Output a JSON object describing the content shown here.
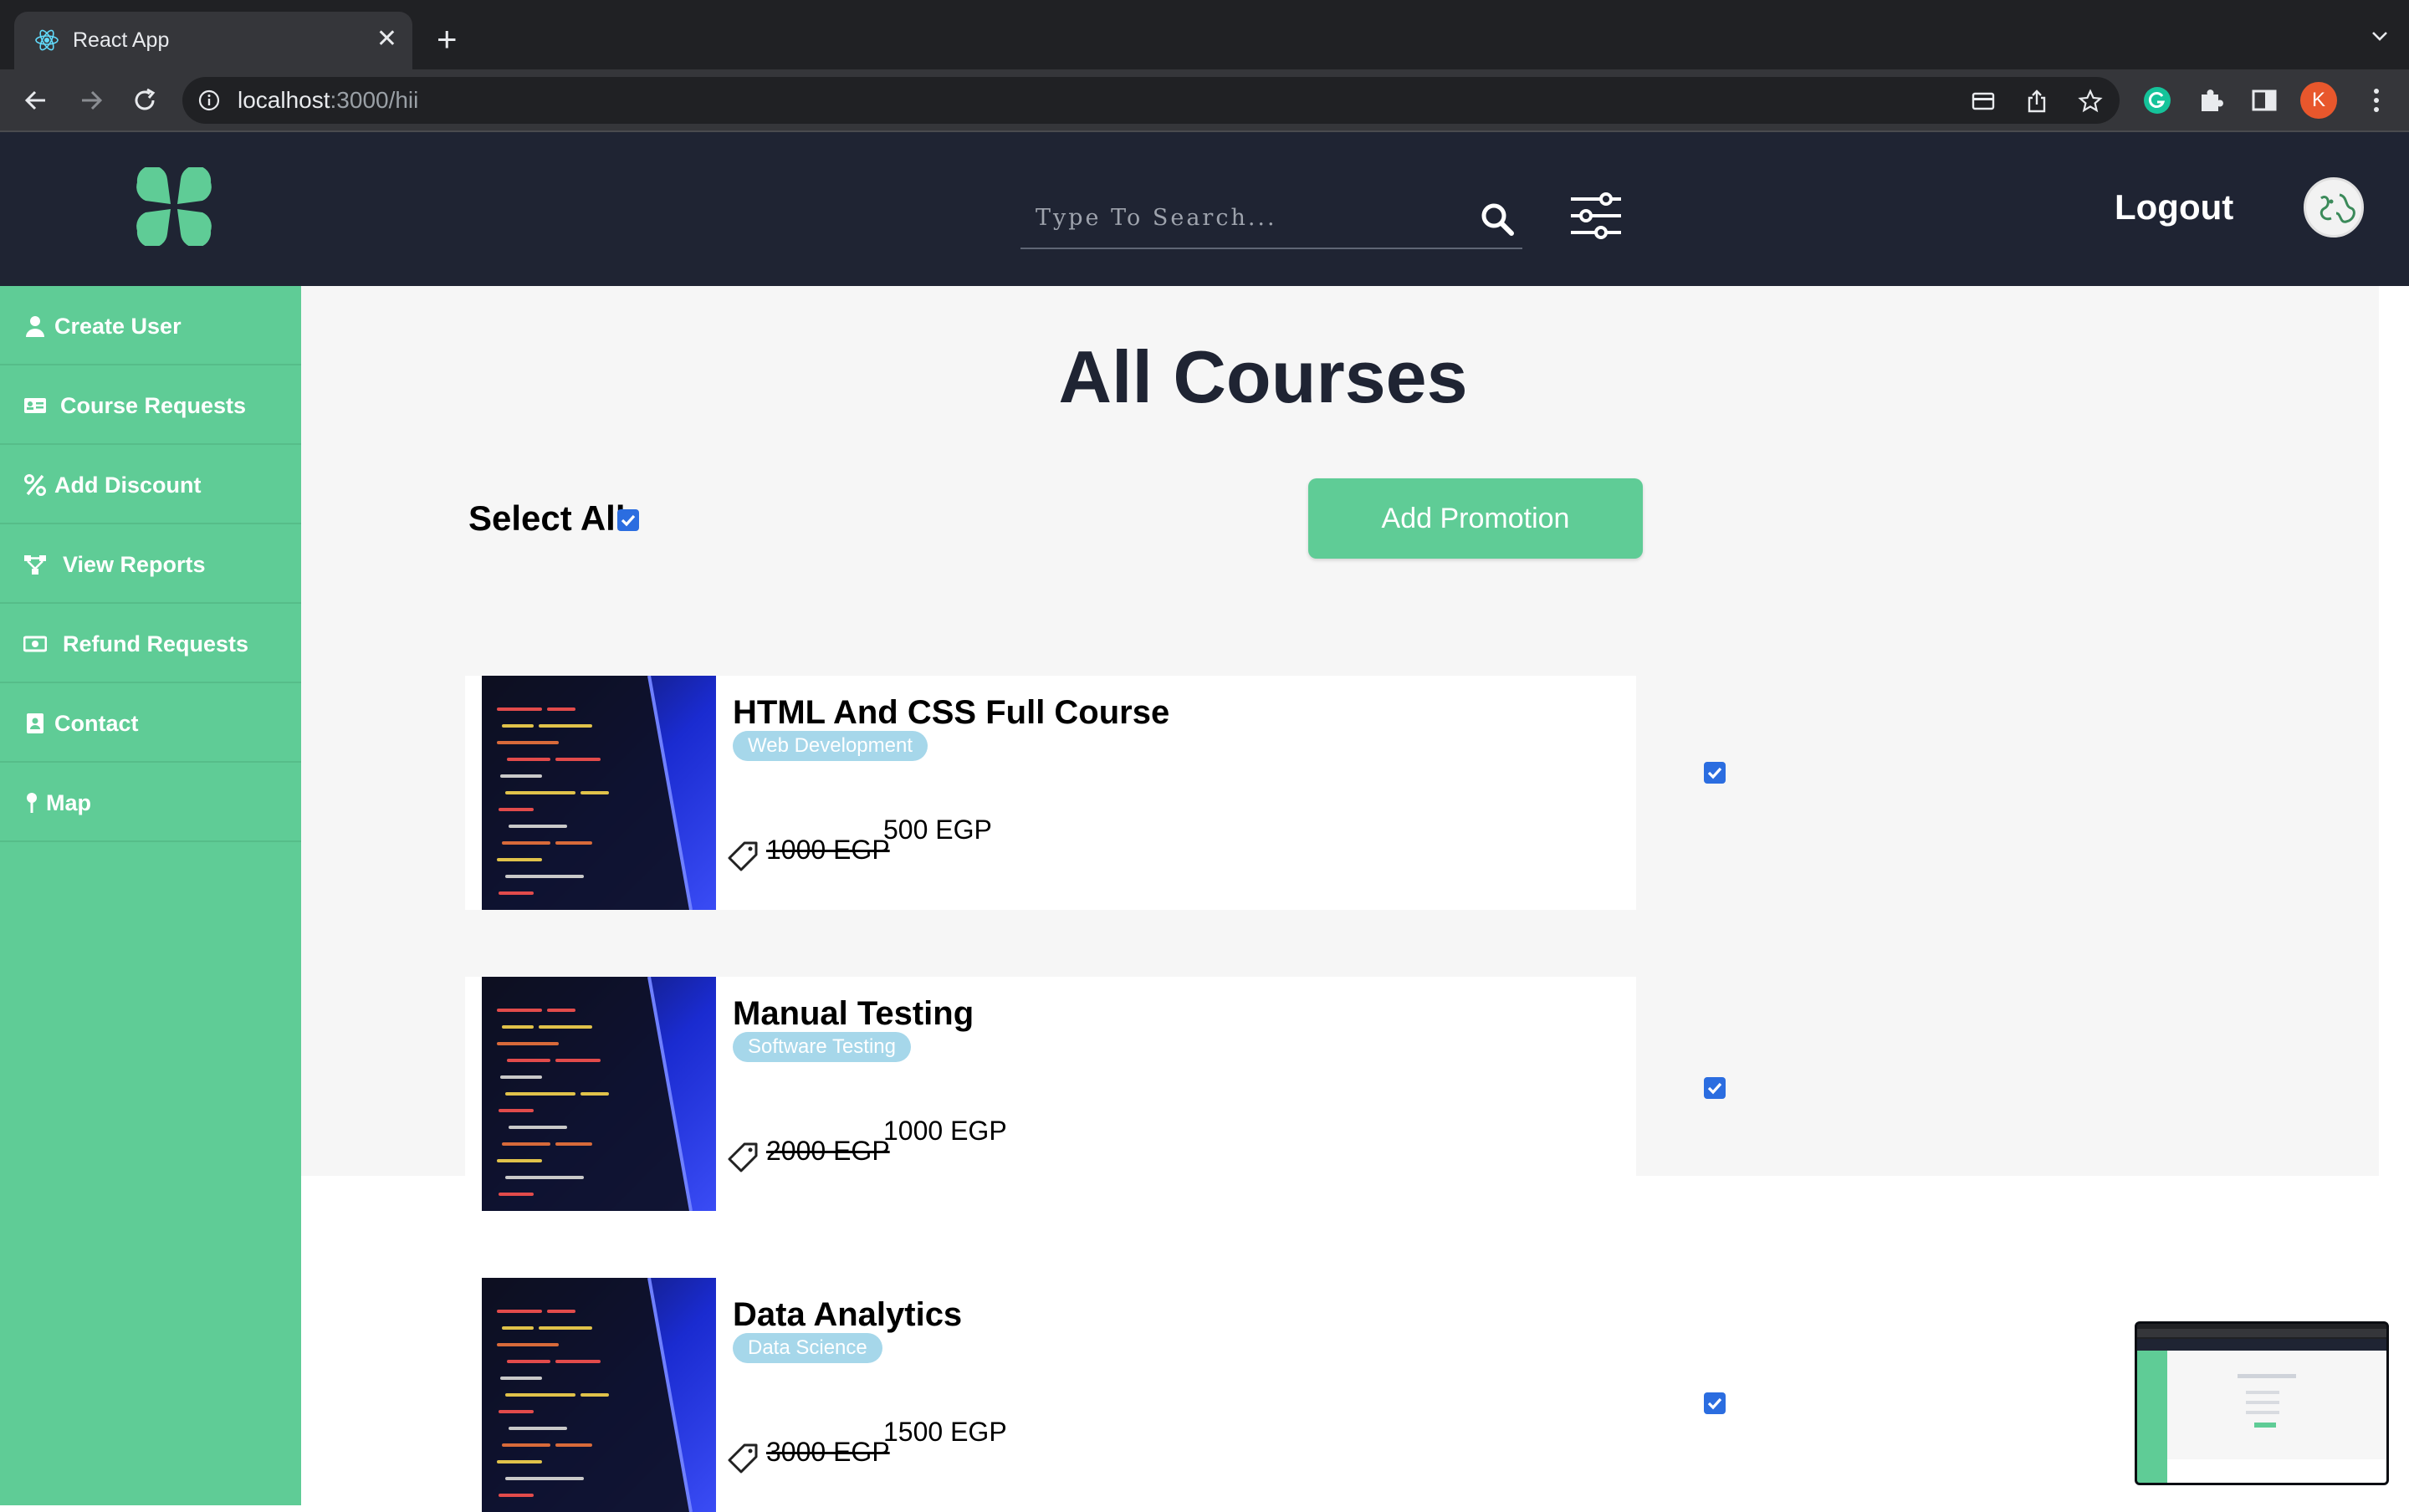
{
  "browser": {
    "tab_title": "React App",
    "url_host": "localhost",
    "url_rest": ":3000/hii",
    "profile_initial": "K"
  },
  "header": {
    "search_placeholder": "Type To Search...",
    "logout_label": "Logout"
  },
  "sidebar": {
    "items": [
      {
        "label": "Create User",
        "icon": "user-icon"
      },
      {
        "label": "Course Requests",
        "icon": "id-card-icon"
      },
      {
        "label": "Add Discount",
        "icon": "percent-icon"
      },
      {
        "label": "View Reports",
        "icon": "sitemap-icon"
      },
      {
        "label": "Refund Requests",
        "icon": "money-bill-icon"
      },
      {
        "label": "Contact",
        "icon": "address-book-icon"
      },
      {
        "label": "Map",
        "icon": "map-pin-icon"
      }
    ]
  },
  "main": {
    "title": "All Courses",
    "select_all_label": "Select All",
    "select_all_checked": true,
    "promotion_button": "Add Promotion",
    "courses": [
      {
        "title": "HTML And CSS Full Course",
        "category": "Web Development",
        "old_price": "1000 EGP",
        "new_price": "500 EGP",
        "checked": true
      },
      {
        "title": "Manual Testing",
        "category": "Software Testing",
        "old_price": "2000 EGP",
        "new_price": "1000 EGP",
        "checked": true
      },
      {
        "title": "Data Analytics",
        "category": "Data Science",
        "old_price": "3000 EGP",
        "new_price": "1500 EGP",
        "checked": true
      }
    ]
  },
  "colors": {
    "accent": "#5fcc96",
    "header_bg": "#1f2433",
    "tag_bg": "#a6d7ea"
  }
}
